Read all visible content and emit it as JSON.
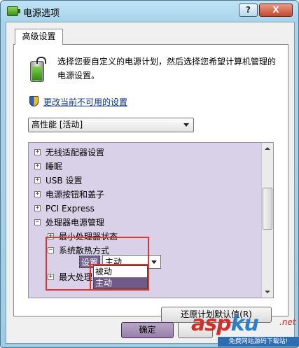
{
  "window": {
    "title": "电源选项",
    "help_label": "?",
    "close_label": "X"
  },
  "tab": {
    "label": "高级设置"
  },
  "intro": {
    "text": "选择您要自定义的电源计划，然后选择您希望计算机管理的电源设置。"
  },
  "change_link": {
    "label": "更改当前不可用的设置"
  },
  "plan_select": {
    "value": "高性能 [活动]"
  },
  "tree": {
    "items": [
      {
        "expander": "+",
        "label": "无线适配器设置"
      },
      {
        "expander": "+",
        "label": "睡眠"
      },
      {
        "expander": "+",
        "label": "USB 设置"
      },
      {
        "expander": "+",
        "label": "电源按钮和盖子"
      },
      {
        "expander": "+",
        "label": "PCI Express"
      },
      {
        "expander": "−",
        "label": "处理器电源管理"
      },
      {
        "expander": "+",
        "label": "最小处理器状态"
      },
      {
        "expander": "−",
        "label": "系统散热方式"
      },
      {
        "expander": "+",
        "label": "最大处理"
      }
    ],
    "setting_label": "设置",
    "setting_value": "主动"
  },
  "dropdown": {
    "options": [
      {
        "label": "被动",
        "selected": false
      },
      {
        "label": "主动",
        "selected": true
      }
    ]
  },
  "buttons": {
    "restore_label": "还原计划默认值(R)",
    "ok_label": "确定"
  },
  "watermark": {
    "brand_a": "asp",
    "brand_b": "ku",
    "suffix": ".net",
    "tagline": "免费网站源码下载站!"
  },
  "colors": {
    "highlight": "#d9d1e8",
    "selection": "#6f5a8a",
    "annotation": "#e03333"
  }
}
